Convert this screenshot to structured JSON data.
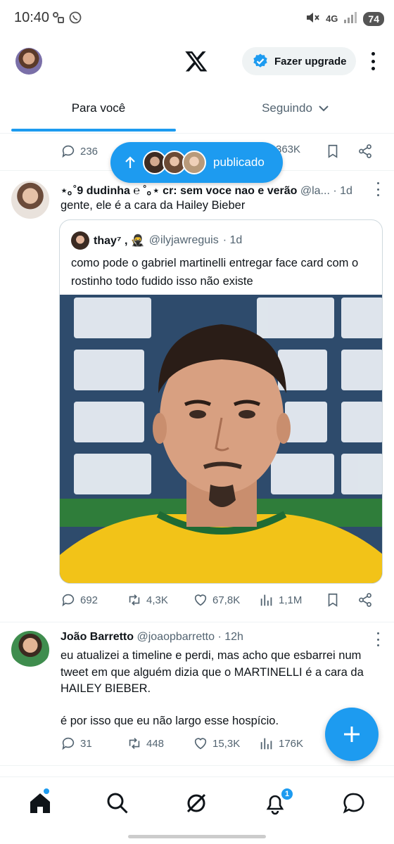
{
  "status_bar": {
    "time": "10:40",
    "network": "4G",
    "battery": "74"
  },
  "header": {
    "upgrade_label": "Fazer upgrade"
  },
  "tabs": [
    {
      "label": "Para você",
      "active": true
    },
    {
      "label": "Seguindo",
      "active": false
    }
  ],
  "top_actions": {
    "replies": "236",
    "views": "363K"
  },
  "published_pill": {
    "label": "publicado"
  },
  "tweet1": {
    "name": "⋆｡˚9 dudinha ℮ ˚｡⋆ cr: sem voce nao e verão",
    "handle": "@la...",
    "time": "· 1d",
    "text": "gente, ele é a cara da Hailey Bieber",
    "quote": {
      "name": "thay⁷ , 🥷",
      "handle": "@ilyjawreguis",
      "time": "· 1d",
      "text": "como pode o gabriel martinelli entregar face card com o rostinho todo fudido isso não existe"
    },
    "actions": {
      "replies": "692",
      "reposts": "4,3K",
      "likes": "67,8K",
      "views": "1,1M"
    }
  },
  "tweet2": {
    "name": "João Barretto",
    "handle": "@joaopbarretto",
    "time": "· 12h",
    "text_line1": "eu atualizei a timeline e perdi, mas acho que esbarrei num tweet em que alguém dizia que o MARTINELLI é a cara da HAILEY BIEBER.",
    "text_line2": "é por isso que eu não largo esse hospício.",
    "actions": {
      "replies": "31",
      "reposts": "448",
      "likes": "15,3K",
      "views": "176K"
    }
  },
  "bottom_nav": {
    "notifications_count": "1"
  },
  "colors": {
    "accent": "#1d9bf0",
    "text": "#0f1419",
    "muted": "#536471",
    "border": "#cfd9de"
  }
}
